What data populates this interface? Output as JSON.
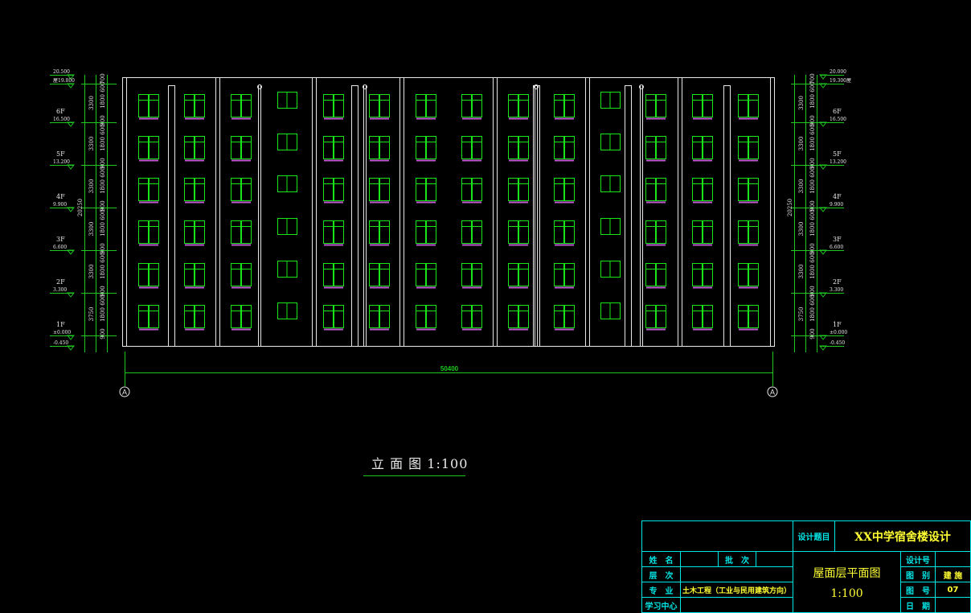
{
  "drawing": {
    "caption": "立 面 图 1:100",
    "overall_dimension": "50400",
    "axis_label": "A",
    "total_height": "20250",
    "floors": 6,
    "bays": 14,
    "colors": {
      "outline": "#e8e8e8",
      "window": "#19e619",
      "sill": "#c05ad0",
      "dimension": "#1ec81e",
      "title": "#ffff33",
      "frame": "#00e5e5"
    },
    "levels_left": [
      {
        "name": "",
        "elev": "20.500"
      },
      {
        "name": "屋",
        "elev": "19.800"
      },
      {
        "name": "6F",
        "elev": "16.500"
      },
      {
        "name": "5F",
        "elev": "13.200"
      },
      {
        "name": "4F",
        "elev": "9.900"
      },
      {
        "name": "3F",
        "elev": "6.600"
      },
      {
        "name": "2F",
        "elev": "3.300"
      },
      {
        "name": "1F",
        "elev": "±0.000"
      },
      {
        "name": "",
        "elev": "-0.450"
      }
    ],
    "levels_right": [
      {
        "name": "",
        "elev": "20.000"
      },
      {
        "name": "屋",
        "elev": "19.300"
      },
      {
        "name": "6F",
        "elev": "16.500"
      },
      {
        "name": "5F",
        "elev": "13.200"
      },
      {
        "name": "4F",
        "elev": "9.900"
      },
      {
        "name": "3F",
        "elev": "6.600"
      },
      {
        "name": "2F",
        "elev": "3.300"
      },
      {
        "name": "1F",
        "elev": "±0.000"
      },
      {
        "name": "",
        "elev": "-0.450"
      }
    ],
    "floor_dims": [
      "3300",
      "3300",
      "3300",
      "3300",
      "3300",
      "3750"
    ],
    "detail_dims": [
      "700",
      "600",
      "1800",
      "900",
      "600",
      "1800",
      "900",
      "600",
      "1800",
      "900",
      "600",
      "1800",
      "900",
      "600",
      "1800",
      "900",
      "600",
      "1800",
      "900"
    ]
  },
  "title_block": {
    "design_topic_label": "设计题目",
    "design_topic": "XX中学宿舍楼设计",
    "name_label": "姓　名",
    "batch_label": "批　次",
    "level_label": "层　次",
    "major_label": "专　业",
    "major": "土木工程（工业与民用建筑方向）",
    "center_label": "学习中心",
    "sheet_title": "屋面层平面图",
    "scale": "1:100",
    "design_no_label": "设计号",
    "category_label": "图　别",
    "category": "建 施",
    "sheet_no_label": "图　号",
    "sheet_no": "07",
    "date_label": "日　期"
  }
}
